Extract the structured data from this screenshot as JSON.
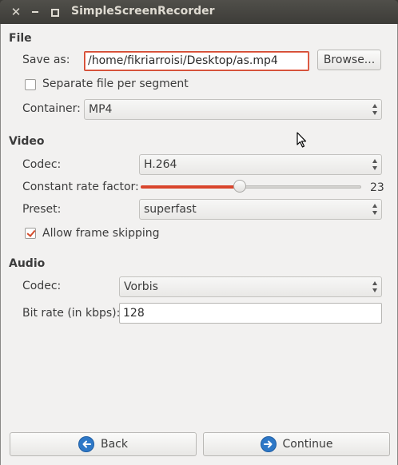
{
  "window": {
    "title": "SimpleScreenRecorder"
  },
  "file": {
    "section_title": "File",
    "save_as_label": "Save as:",
    "save_as_value": "/home/fikriarroisi/Desktop/as.mp4",
    "browse_label": "Browse...",
    "separate_file_label": "Separate file per segment",
    "separate_file_checked": false,
    "container_label": "Container:",
    "container_value": "MP4"
  },
  "video": {
    "section_title": "Video",
    "codec_label": "Codec:",
    "codec_value": "H.264",
    "crf_label": "Constant rate factor:",
    "crf_value": "23",
    "crf_fraction": 0.45,
    "preset_label": "Preset:",
    "preset_value": "superfast",
    "frame_skip_label": "Allow frame skipping",
    "frame_skip_checked": true
  },
  "audio": {
    "section_title": "Audio",
    "codec_label": "Codec:",
    "codec_value": "Vorbis",
    "bitrate_label": "Bit rate (in kbps):",
    "bitrate_value": "128"
  },
  "footer": {
    "back_label": "Back",
    "continue_label": "Continue"
  },
  "colors": {
    "accent": "#d9452c",
    "button_icon": "#2e78c7",
    "titlebar": "#3c3b37"
  }
}
